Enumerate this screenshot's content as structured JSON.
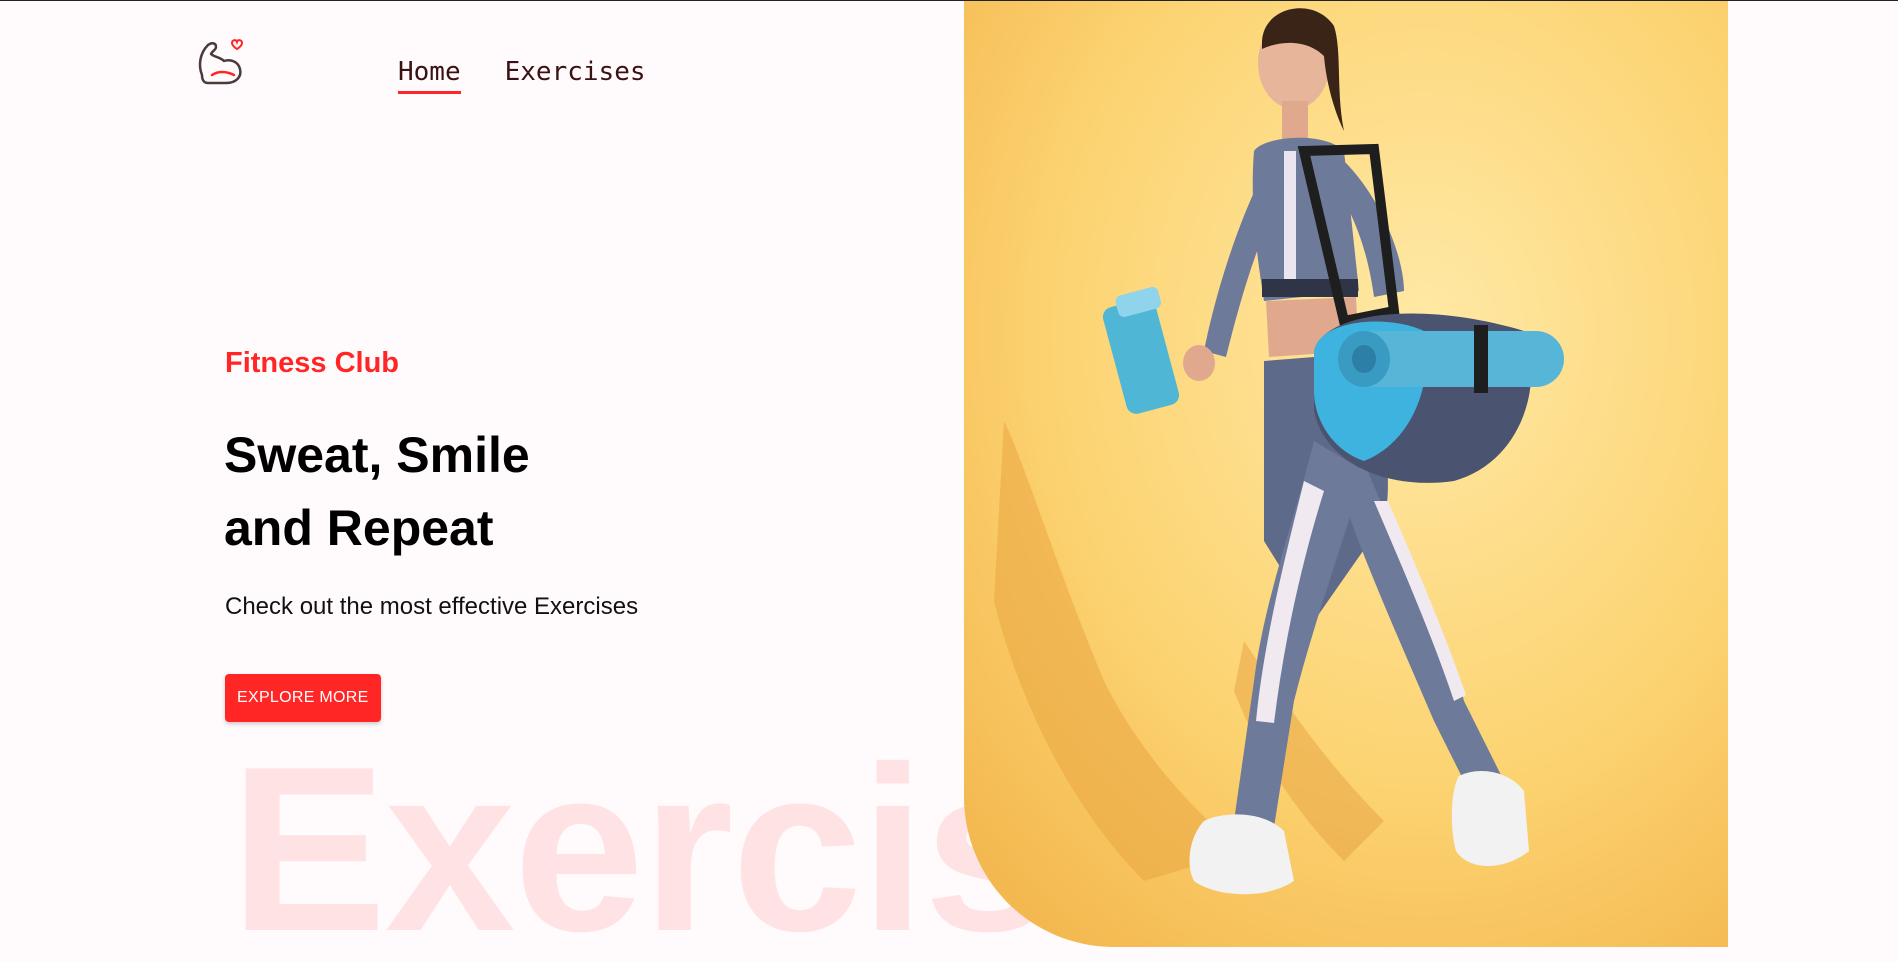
{
  "navbar": {
    "logo_icon": "flexed-arm-heart-icon",
    "links": [
      {
        "label": "Home",
        "active": true
      },
      {
        "label": "Exercises",
        "active": false
      }
    ]
  },
  "hero": {
    "eyebrow": "Fitness Club",
    "headline_line1": "Sweat, Smile",
    "headline_line2": "and Repeat",
    "subtitle": "Check out the most effective Exercises",
    "cta_label": "EXPLORE MORE",
    "watermark": "Exercis",
    "image_alt": "woman walking with yoga mat and water bottle"
  },
  "colors": {
    "accent": "#ff2625",
    "background": "#fffafb",
    "image_bg": "#fcd371"
  }
}
